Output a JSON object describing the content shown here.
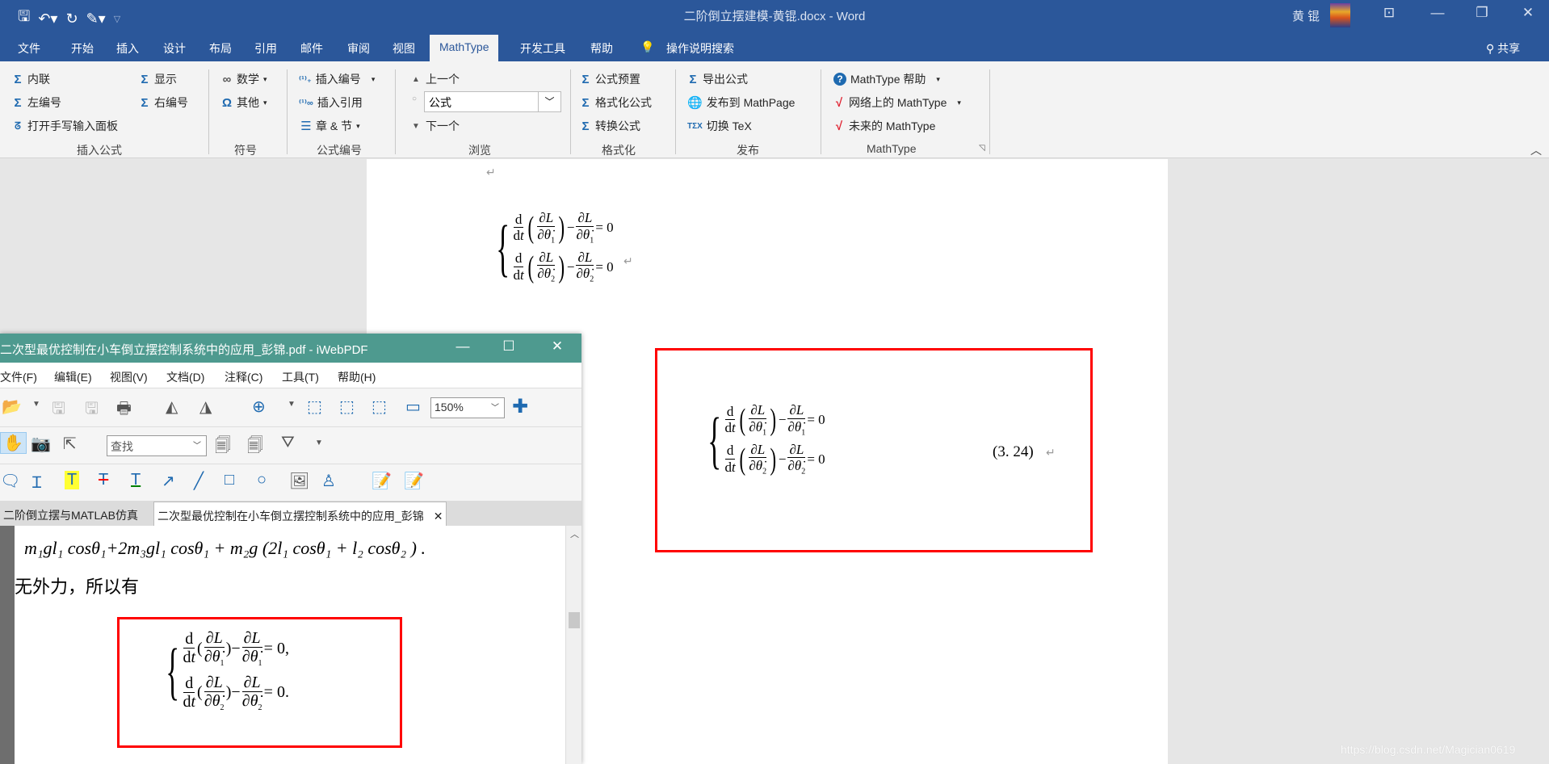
{
  "word": {
    "title": "二阶倒立摆建模-黄锟.docx  -  Word",
    "user": "黄 锟",
    "qat": {
      "save_icon": "save-icon",
      "undo_icon": "undo-icon",
      "redo_icon": "redo-icon",
      "format_icon": "format-painter-icon",
      "customize_icon": "customize-icon"
    },
    "tabs": [
      "文件",
      "开始",
      "插入",
      "设计",
      "布局",
      "引用",
      "邮件",
      "审阅",
      "视图",
      "MathType",
      "开发工具",
      "帮助",
      "操作说明搜索"
    ],
    "active_tab": "MathType",
    "share": "共享",
    "ribbon": {
      "insert_equation": {
        "items": [
          "内联",
          "左编号",
          "打开手写输入面板",
          "显示",
          "右编号"
        ],
        "label": "插入公式"
      },
      "symbols": {
        "items": [
          "数学",
          "其他"
        ],
        "label": "符号"
      },
      "equation_numbers": {
        "items": [
          "插入编号",
          "插入引用",
          "章 & 节"
        ],
        "label": "公式编号"
      },
      "browse": {
        "prev": "上一个",
        "combo_value": "公式",
        "next": "下一个",
        "label": "浏览"
      },
      "format": {
        "items": [
          "公式预置",
          "格式化公式",
          "转换公式"
        ],
        "label": "格式化"
      },
      "publish": {
        "items": [
          "导出公式",
          "发布到 MathPage",
          "切换 TeX"
        ],
        "label": "发布"
      },
      "mathtype": {
        "items": [
          "MathType 帮助",
          "网络上的 MathType",
          "未来的 MathType"
        ],
        "label": "MathType"
      }
    },
    "document": {
      "equation1": {
        "rows": [
          {
            "sub": "1",
            "rhs": "= 0"
          },
          {
            "sub": "2",
            "rhs": "= 0"
          }
        ]
      },
      "equation2": {
        "rows": [
          {
            "sub": "1",
            "rhs": "= 0"
          },
          {
            "sub": "2",
            "rhs": "= 0"
          }
        ],
        "number": "(3. 24)"
      },
      "para_mark": "↵"
    }
  },
  "pdf": {
    "title": "二次型最优控制在小车倒立摆控制系统中的应用_彭锦.pdf - iWebPDF",
    "menu": [
      "文件(F)",
      "编辑(E)",
      "视图(V)",
      "文档(D)",
      "注释(C)",
      "工具(T)",
      "帮助(H)"
    ],
    "zoom": "150%",
    "search_placeholder": "查找",
    "tabs": [
      "二阶倒立摆与MATLAB仿真",
      "二次型最优控制在小车倒立摆控制系统中的应用_彭锦"
    ],
    "active_tab_index": 1,
    "content": {
      "formula_line": "m₁gl₁ cosθ₁+2m₃gl₁ cosθ₁ + m₂g (2l₁ cosθ₁ + l₂ cosθ₂ ) .",
      "text": "无外力，所以有",
      "equation": {
        "rows": [
          {
            "sub": "1",
            "rhs": "= 0,"
          },
          {
            "sub": "2",
            "rhs": "= 0."
          }
        ]
      }
    }
  },
  "watermark": "https://blog.csdn.net/Magician0619"
}
